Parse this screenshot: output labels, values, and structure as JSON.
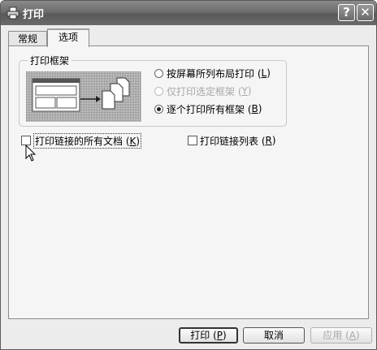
{
  "window": {
    "title": "打印",
    "help_label": "?",
    "close_label": "✕"
  },
  "tabs": [
    {
      "label": "常规"
    },
    {
      "label": "选项"
    }
  ],
  "frames_group": {
    "legend": "打印框架",
    "options": [
      {
        "label": "按屏幕所列布局打印 (",
        "hotkey": "L",
        "suffix": ")",
        "selected": false,
        "enabled": true
      },
      {
        "label": "仅打印选定框架 (",
        "hotkey": "Y",
        "suffix": ")",
        "selected": false,
        "enabled": false
      },
      {
        "label": "逐个打印所有框架 (",
        "hotkey": "B",
        "suffix": ")",
        "selected": true,
        "enabled": true
      }
    ]
  },
  "checkboxes": {
    "linked_docs": {
      "label": "打印链接的所有文档 (",
      "hotkey": "K",
      "suffix": ")",
      "checked": false
    },
    "link_table": {
      "label": "打印链接列表 (",
      "hotkey": "R",
      "suffix": ")",
      "checked": false
    }
  },
  "buttons": {
    "print": {
      "label": "打印 (",
      "hotkey": "P",
      "suffix": ")"
    },
    "cancel": {
      "label": "取消"
    },
    "apply": {
      "label": "应用 (",
      "hotkey": "A",
      "suffix": ")",
      "enabled": false
    }
  }
}
